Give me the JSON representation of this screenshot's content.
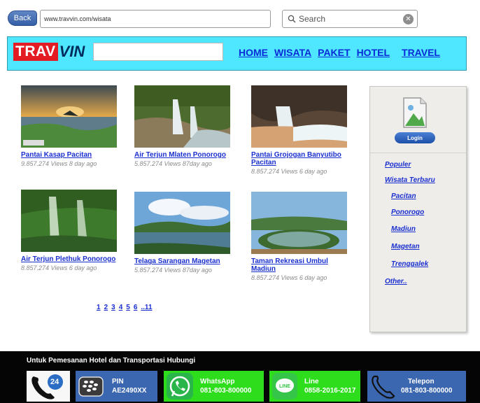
{
  "browser": {
    "back_label": "Back",
    "url": "www.travvin.com/wisata",
    "search_placeholder": "Search"
  },
  "header": {
    "logo_part1": "TRAV",
    "logo_part2": "VIN",
    "nav": [
      "HOME",
      "WISATA",
      "PAKET",
      "HOTEL",
      "TRAVEL"
    ]
  },
  "cards": [
    {
      "title": "Pantai Kasap Pacitan",
      "meta": "9.857.274 Views 8 day ago"
    },
    {
      "title": "Air Terjun Mlaten Ponorogo",
      "meta": "5.857.274 Views 87day ago"
    },
    {
      "title": "Pantai Grojogan Banyutibo Pacitan",
      "meta": "8.857.274 Views 6 day ago"
    },
    {
      "title": "Air Terjun Plethuk Ponorogo",
      "meta": "8.857.274 Views 6 day ago"
    },
    {
      "title": "Telaga Sarangan Magetan",
      "meta": "5.857.274 Views 87day ago"
    },
    {
      "title": "Taman Rekreasi Umbul Madiun",
      "meta": "8.857.274 Views 6 day ago"
    }
  ],
  "sidebar": {
    "login_label": "Login",
    "links": [
      "Populer",
      "Wisata Terbaru",
      "Pacitan",
      "Ponorogo",
      "Madiun",
      "Magetan",
      "Trenggalek",
      "Other.."
    ]
  },
  "pagination": [
    "1",
    "2",
    "3",
    "4",
    "5",
    "6",
    "..11"
  ],
  "footer": {
    "title": "Untuk Pemesanan Hotel dan Transportasi Hubungi",
    "badge": "24",
    "pin_label": "PIN",
    "pin_value": "AE2490XX",
    "whatsapp_label": "WhatsApp",
    "whatsapp_value": "081-803-800000",
    "line_label": "Line",
    "line_value": "0858-2016-2017",
    "phone_label": "Telepon",
    "phone_value": "081-803-800000",
    "colors": {
      "pin": "#3a67b0",
      "whatsapp": "#2ede1c",
      "line": "#2ede1c",
      "phone": "#3a67b0"
    }
  }
}
